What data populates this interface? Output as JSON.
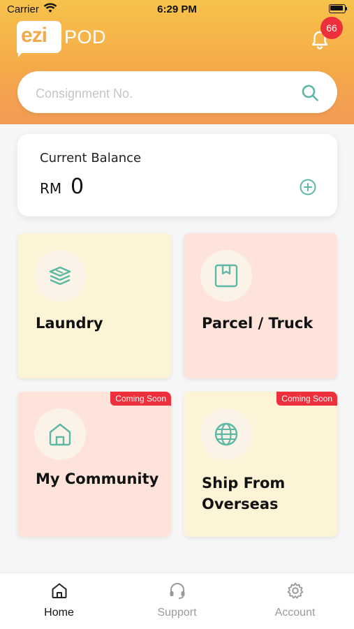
{
  "status_bar": {
    "carrier": "Carrier",
    "time": "6:29 PM"
  },
  "app": {
    "logo_primary": "ezi",
    "logo_secondary": "POD"
  },
  "notifications": {
    "count": "66"
  },
  "search": {
    "placeholder": "Consignment No."
  },
  "balance": {
    "label": "Current Balance",
    "currency": "RM",
    "amount": "0"
  },
  "services": [
    {
      "title": "Laundry",
      "icon": "layers-icon",
      "badge": ""
    },
    {
      "title": "Parcel / Truck",
      "icon": "box-icon",
      "badge": ""
    },
    {
      "title": "My Community",
      "icon": "home-icon",
      "badge": "Coming Soon"
    },
    {
      "title": "Ship From Overseas",
      "title_line1": "Ship From",
      "title_line2": "Overseas",
      "icon": "globe-icon",
      "badge": "Coming Soon"
    }
  ],
  "tabs": [
    {
      "label": "Home",
      "icon": "home-icon",
      "active": true
    },
    {
      "label": "Support",
      "icon": "headset-icon",
      "active": false
    },
    {
      "label": "Account",
      "icon": "gear-icon",
      "active": false
    }
  ],
  "colors": {
    "accent_teal": "#5cb8a4",
    "header_orange": "#f5a84a",
    "badge_red": "#ee2f3c",
    "tile_yellow": "#fdf3d6",
    "tile_pink": "#fde3da"
  }
}
